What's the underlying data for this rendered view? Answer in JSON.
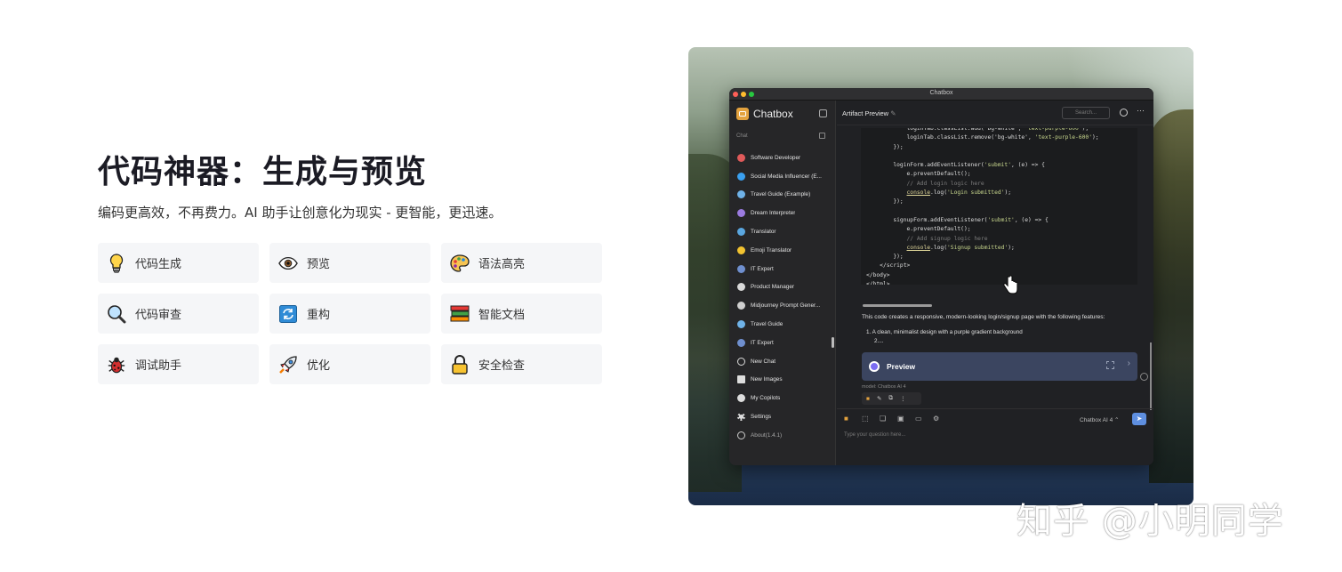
{
  "hero": {
    "title": "代码神器：生成与预览",
    "subtitle": "编码更高效，不再费力。AI 助手让创意化为现实 - 更智能，更迅速。"
  },
  "features": [
    {
      "label": "代码生成",
      "icon": "lightbulb-icon"
    },
    {
      "label": "预览",
      "icon": "eye-icon"
    },
    {
      "label": "语法高亮",
      "icon": "palette-icon"
    },
    {
      "label": "代码审查",
      "icon": "magnifier-icon"
    },
    {
      "label": "重构",
      "icon": "refresh-icon"
    },
    {
      "label": "智能文档",
      "icon": "books-icon"
    },
    {
      "label": "调试助手",
      "icon": "bug-icon"
    },
    {
      "label": "优化",
      "icon": "rocket-icon"
    },
    {
      "label": "安全检查",
      "icon": "lock-icon"
    }
  ],
  "app": {
    "window_title": "Chatbox",
    "brand": "Chatbox",
    "chat_section": "Chat",
    "chats": [
      {
        "label": "Software Developer",
        "color": "#e05a5a"
      },
      {
        "label": "Social Media Influencer (E...",
        "color": "#3aa0f0"
      },
      {
        "label": "Travel Guide (Example)",
        "color": "#6fb2e8"
      },
      {
        "label": "Dream Interpreter",
        "color": "#9b7be0"
      },
      {
        "label": "Translator",
        "color": "#5aa6e0"
      },
      {
        "label": "Emoji Translator",
        "color": "#f2c230"
      },
      {
        "label": "IT Expert",
        "color": "#6f8fcf"
      },
      {
        "label": "Product Manager",
        "color": "#d9d9d9"
      },
      {
        "label": "Midjourney Prompt Gener...",
        "color": "#cfcfcf"
      },
      {
        "label": "Travel Guide",
        "color": "#6fb2e8"
      },
      {
        "label": "IT Expert",
        "color": "#6f8fcf"
      }
    ],
    "nav": [
      {
        "label": "New Chat",
        "icon": "plus-circle-icon"
      },
      {
        "label": "New Images",
        "icon": "image-icon"
      },
      {
        "label": "My Copilots",
        "icon": "copilot-icon"
      },
      {
        "label": "Settings",
        "icon": "gear-icon"
      },
      {
        "label": "About(1.4.1)",
        "icon": "info-icon"
      }
    ],
    "header_title": "Artifact Preview",
    "search_placeholder": "Search...",
    "description": "This code creates a responsive, modern-looking login/signup page with the following features:",
    "list_item_1": "1. A clean, minimalist design with a purple gradient background",
    "list_item_2": "2....",
    "preview_label": "Preview",
    "model_label": "model: Chatbox AI 4",
    "model_selector": "Chatbox AI 4 ⌃",
    "input_placeholder": "Type your question here..."
  },
  "watermark": "知乎 @小明同学",
  "colors": {
    "accent": "#5e8fe0",
    "preview_bg": "#3b4560",
    "brand_logo": "#e3a23e"
  }
}
